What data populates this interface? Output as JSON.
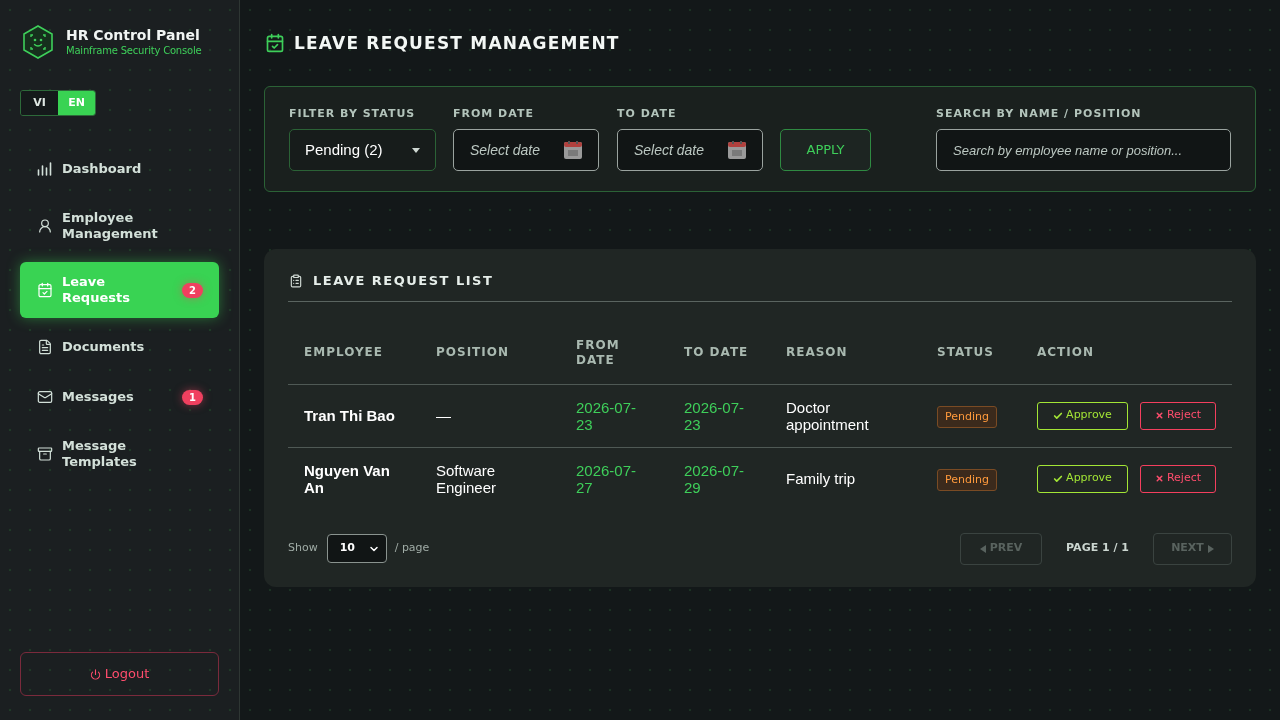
{
  "sidebar": {
    "brand": {
      "title": "HR Control Panel",
      "subtitle": "Mainframe Security Console"
    },
    "languages": [
      {
        "label": "VI",
        "selected": false
      },
      {
        "label": "EN",
        "selected": true
      }
    ],
    "nav": [
      {
        "label": "Dashboard",
        "selected": false
      },
      {
        "label": "Employee Management",
        "selected": false
      },
      {
        "label": "Leave Requests",
        "selected": true,
        "badge": "2"
      },
      {
        "label": "Documents",
        "selected": false
      },
      {
        "label": "Messages",
        "selected": false,
        "badge": "1"
      },
      {
        "label": "Message Templates",
        "selected": false
      }
    ],
    "logout": "Logout"
  },
  "page": {
    "title": "LEAVE REQUEST MANAGEMENT"
  },
  "filters": {
    "status": {
      "label": "FILTER BY STATUS",
      "value": "Pending (2)"
    },
    "from_date": {
      "label": "FROM DATE",
      "placeholder": "Select date"
    },
    "to_date": {
      "label": "TO DATE",
      "placeholder": "Select date"
    },
    "apply": "APPLY",
    "search": {
      "label": "SEARCH BY NAME / POSITION",
      "placeholder": "Search by employee name or position..."
    }
  },
  "leave_list": {
    "title": "LEAVE REQUEST LIST",
    "columns": [
      "EMPLOYEE",
      "POSITION",
      "FROM DATE",
      "TO DATE",
      "REASON",
      "STATUS",
      "ACTION"
    ],
    "rows": [
      {
        "employee": "Tran Thi Bao",
        "position": "—",
        "from_date": "2026-07-23",
        "to_date": "2026-07-23",
        "reason": "Doctor appointment",
        "status": {
          "label": "Pending",
          "kind": "pending"
        },
        "actions": [
          {
            "label": "Approve",
            "kind": "approve"
          },
          {
            "label": "Reject",
            "kind": "reject"
          }
        ]
      },
      {
        "employee": "Nguyen Van An",
        "position": "Software Engineer",
        "from_date": "2026-07-27",
        "to_date": "2026-07-29",
        "reason": "Family trip",
        "status": {
          "label": "Pending",
          "kind": "pending"
        },
        "actions": [
          {
            "label": "Approve",
            "kind": "approve"
          },
          {
            "label": "Reject",
            "kind": "reject"
          }
        ]
      }
    ],
    "pagination": {
      "show_label": "Show",
      "page_size": "10",
      "page_size_suffix": "/ page",
      "prev": {
        "label": "PREV",
        "disabled": true
      },
      "page_info": "PAGE 1 / 1",
      "next": {
        "label": "NEXT",
        "disabled": true
      }
    }
  }
}
